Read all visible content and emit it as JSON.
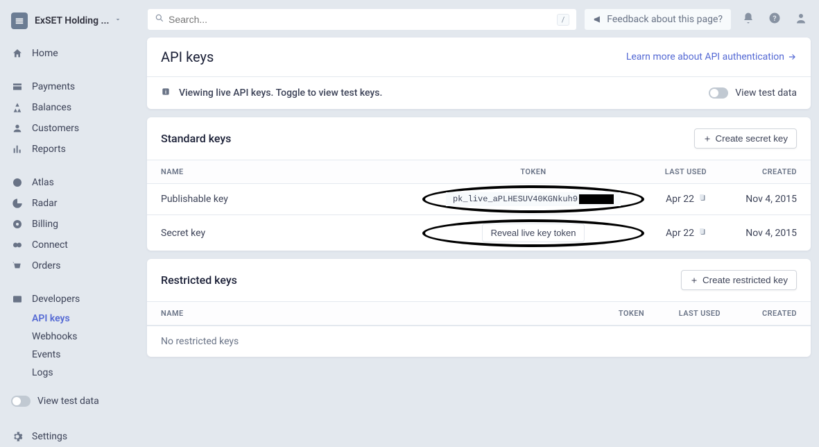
{
  "org": {
    "name": "ExSET Holding ..."
  },
  "search": {
    "placeholder": "Search...",
    "shortcut": "/"
  },
  "feedback": {
    "label": "Feedback about this page?"
  },
  "nav": {
    "home": "Home",
    "payments": "Payments",
    "balances": "Balances",
    "customers": "Customers",
    "reports": "Reports",
    "atlas": "Atlas",
    "radar": "Radar",
    "billing": "Billing",
    "connect": "Connect",
    "orders": "Orders",
    "developers": "Developers",
    "apikeys": "API keys",
    "webhooks": "Webhooks",
    "events": "Events",
    "logs": "Logs",
    "viewtest": "View test data",
    "settings": "Settings"
  },
  "page": {
    "title": "API keys",
    "learn": "Learn more about API authentication",
    "banner": "Viewing live API keys. Toggle to view test keys.",
    "viewtest": "View test data"
  },
  "std": {
    "title": "Standard keys",
    "create": "Create secret key",
    "cols": {
      "name": "NAME",
      "token": "TOKEN",
      "last": "LAST USED",
      "created": "CREATED"
    },
    "rows": [
      {
        "name": "Publishable key",
        "token": "pk_live_aPLHESUV40KGNkuh9",
        "last": "Apr 22",
        "created": "Nov 4, 2015"
      },
      {
        "name": "Secret key",
        "reveal": "Reveal live key token",
        "last": "Apr 22",
        "created": "Nov 4, 2015"
      }
    ]
  },
  "res": {
    "title": "Restricted keys",
    "create": "Create restricted key",
    "cols": {
      "name": "NAME",
      "token": "TOKEN",
      "last": "LAST USED",
      "created": "CREATED"
    },
    "empty": "No restricted keys"
  }
}
